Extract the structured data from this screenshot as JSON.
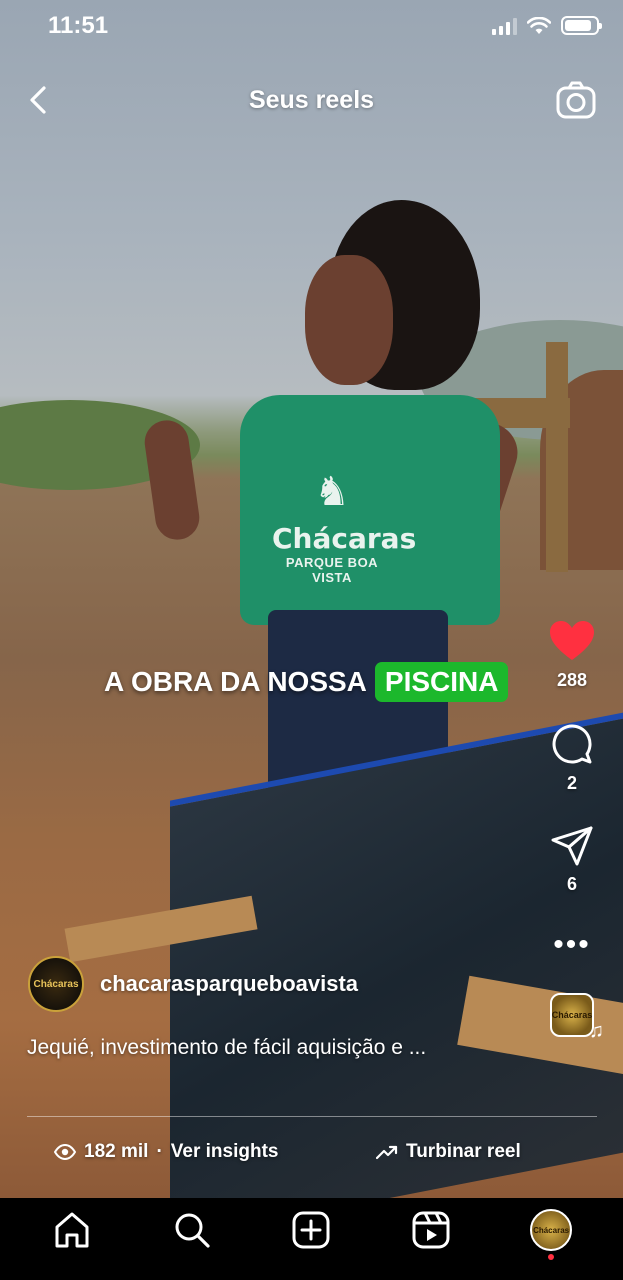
{
  "status_bar": {
    "time": "11:51",
    "battery_level": 0.85
  },
  "header": {
    "title": "Seus reels",
    "back_icon": "chevron-left-icon",
    "camera_icon": "camera-icon"
  },
  "video": {
    "caption_text": "A OBRA DA NOSSA",
    "caption_highlight": "PISCINA",
    "caption_highlight_color": "#1cb82c",
    "shirt_brand": "Chácaras",
    "shirt_sub": "PARQUE BOA VISTA"
  },
  "actions": {
    "likes": "288",
    "comments": "2",
    "shares": "6",
    "like_color": "#ff3040",
    "audio_thumb_label": "Chácaras"
  },
  "author": {
    "avatar_label": "Chácaras",
    "username": "chacarasparqueboavista",
    "description": "Jequié, investimento de fácil aquisição e ..."
  },
  "insights": {
    "views": "182 mil",
    "separator": "·",
    "insights_label": "Ver insights",
    "boost_label": "Turbinar reel"
  },
  "bottom_nav": {
    "items": [
      "home-icon",
      "search-icon",
      "create-icon",
      "reels-icon",
      "profile-avatar"
    ],
    "profile_label": "Chácaras",
    "notification_color": "#ff3040"
  }
}
